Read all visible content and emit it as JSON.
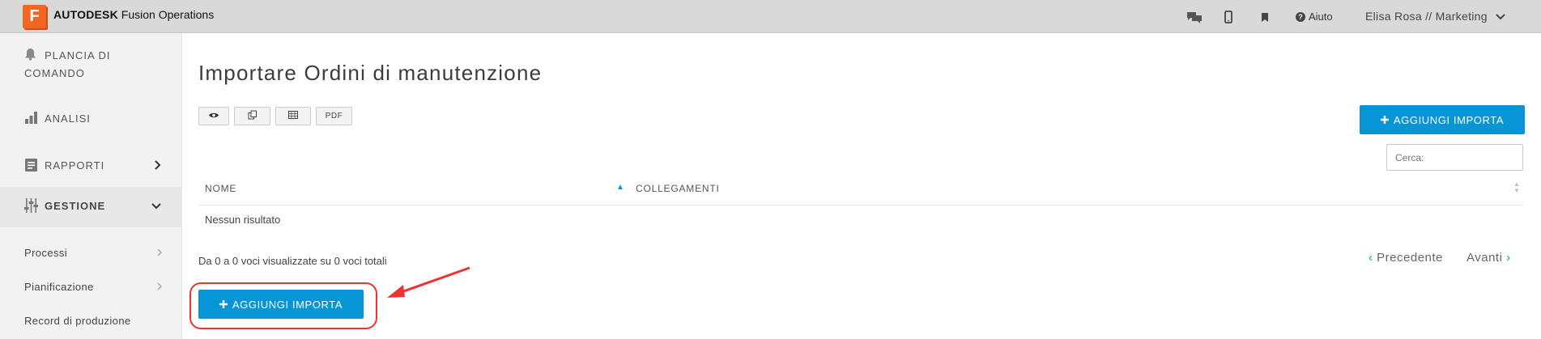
{
  "header": {
    "logo_letter": "F",
    "brand_bold": "AUTODESK",
    "brand_rest": " Fusion Operations",
    "help_label": "Aiuto",
    "user_label": "Elisa Rosa // Marketing",
    "icons": [
      "chat-icon",
      "mobile-icon",
      "bookmark-icon",
      "help-icon",
      "chevron-down-icon"
    ]
  },
  "sidebar": {
    "items": [
      {
        "label_line1": "PLANCIA DI",
        "label_line2": "COMANDO",
        "icon": "bell-icon"
      },
      {
        "label": "ANALISI",
        "icon": "bar-chart-icon"
      },
      {
        "label": "RAPPORTI",
        "icon": "report-icon"
      },
      {
        "label": "GESTIONE",
        "icon": "sliders-icon"
      }
    ],
    "subitems": [
      {
        "label": "Processi"
      },
      {
        "label": "Pianificazione"
      },
      {
        "label": "Record di produzione"
      }
    ]
  },
  "main": {
    "title": "Importare Ordini di manutenzione",
    "toolbar": {
      "view_icon": "eye-icon",
      "copy_icon": "copy-icon",
      "csv_icon": "table-icon",
      "pdf_label": "PDF"
    },
    "add_button_label": "AGGIUNGI IMPORTA",
    "search_placeholder": "Cerca:",
    "table": {
      "columns": [
        "NOME",
        "COLLEGAMENTI"
      ],
      "empty_text": "Nessun risultato"
    },
    "info_text": "Da 0 a 0 voci visualizzate su 0 voci totali",
    "pagination": {
      "prev": "Precedente",
      "next": "Avanti"
    }
  },
  "colors": {
    "accent": "#0696d7",
    "brand": "#f26522",
    "annotation": "#e33333"
  }
}
